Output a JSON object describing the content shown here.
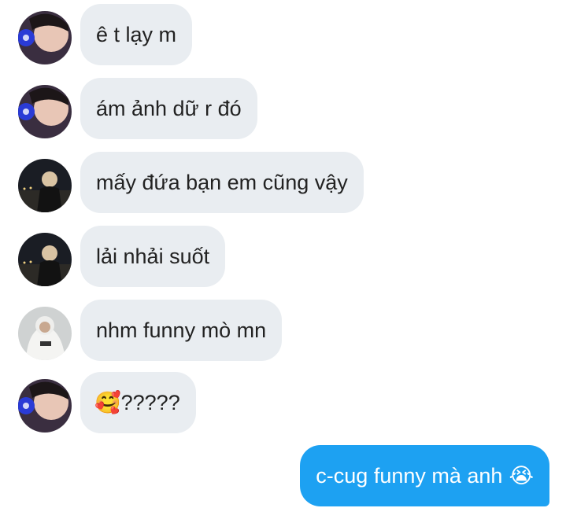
{
  "messages": [
    {
      "sender": "user-a",
      "text": "ê t lạy m"
    },
    {
      "sender": "user-a",
      "text": "ám ảnh dữ r đó"
    },
    {
      "sender": "user-b",
      "text": "mấy đứa bạn em cũng vậy"
    },
    {
      "sender": "user-b",
      "text": "lải nhải suốt"
    },
    {
      "sender": "user-c",
      "text": "nhm funny mò mn"
    },
    {
      "sender": "user-a",
      "emoji": "🥰",
      "text": "?????"
    },
    {
      "sender": "me",
      "text": "c-cug funny mà anh",
      "emoji": "😭"
    }
  ],
  "colors": {
    "received_bubble": "#e9edf1",
    "sent_bubble": "#1da1f2"
  }
}
